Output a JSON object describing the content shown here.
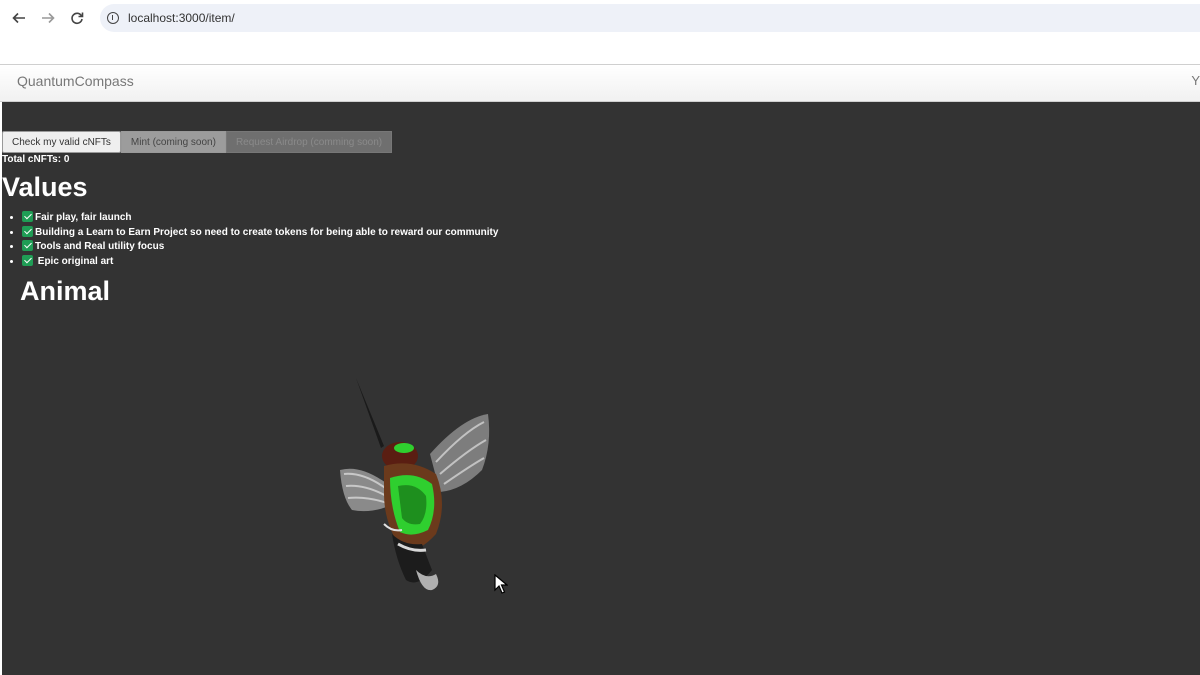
{
  "browser": {
    "url": "localhost:3000/item/"
  },
  "navbar": {
    "brand": "QuantumCompass",
    "right_fragment": "Y"
  },
  "buttons": {
    "check": "Check my valid cNFTs",
    "mint": "Mint (coming soon)",
    "airdrop": "Request Airdrop (comming soon)"
  },
  "total_cnfts": "Total cNFTs: 0",
  "values": {
    "heading": "Values",
    "items": [
      "Fair play, fair launch",
      "Building a Learn to Earn Project so need to create tokens for being able to reward our community",
      "Tools and Real utility focus",
      " Epic original art"
    ]
  },
  "animal": {
    "heading": "Animal"
  },
  "colors": {
    "background": "#333333",
    "check_green": "#1f9d55",
    "bird_green": "#2fcf2f"
  },
  "icons": {
    "back": "arrow-left-icon",
    "forward": "arrow-right-icon",
    "reload": "reload-icon",
    "info": "info-icon",
    "check": "checkmark-icon",
    "cursor": "mouse-cursor-icon"
  }
}
